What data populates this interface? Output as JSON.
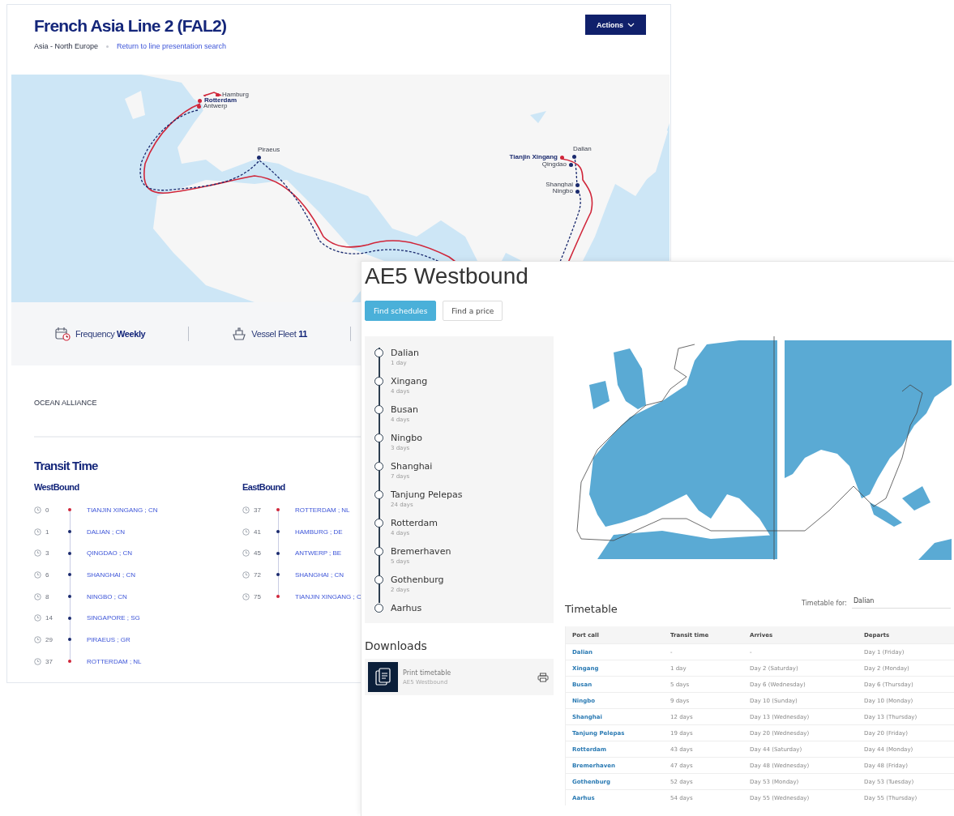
{
  "line_page": {
    "title": "French Asia Line 2 (FAL2)",
    "trade": "Asia - North Europe",
    "back_link": "Return to line presentation search",
    "actions_button": "Actions",
    "map": {
      "ports": [
        {
          "label": "Hamburg",
          "emphasized": false,
          "color": "#d0263a"
        },
        {
          "label": "Rotterdam",
          "emphasized": true,
          "color": "#d0263a"
        },
        {
          "label": "Antwerp",
          "emphasized": false,
          "color": "#d0263a"
        },
        {
          "label": "Piraeus",
          "emphasized": false,
          "color": "#1a2a6e"
        },
        {
          "label": "Tianjin Xingang",
          "emphasized": true,
          "color": "#d0263a"
        },
        {
          "label": "Dalian",
          "emphasized": false,
          "color": "#1a2a6e"
        },
        {
          "label": "Qingdao",
          "emphasized": false,
          "color": "#1a2a6e"
        },
        {
          "label": "Shanghai",
          "emphasized": false,
          "color": "#1a2a6e"
        },
        {
          "label": "Ningbo",
          "emphasized": false,
          "color": "#1a2a6e"
        }
      ]
    },
    "stats": [
      {
        "kind": "frequency",
        "label": "Frequency",
        "value": "Weekly"
      },
      {
        "kind": "fleet",
        "label": "Vessel Fleet",
        "value": "11"
      }
    ],
    "alliance": "OCEAN ALLIANCE",
    "transit_title": "Transit Time",
    "directions": [
      {
        "title": "WestBound",
        "stops": [
          {
            "days": "0",
            "port": "TIANJIN XINGANG ; CN",
            "color": "#d0263a"
          },
          {
            "days": "1",
            "port": "DALIAN ; CN",
            "color": "#1a2a6e"
          },
          {
            "days": "3",
            "port": "QINGDAO ; CN",
            "color": "#1a2a6e"
          },
          {
            "days": "6",
            "port": "SHANGHAI ; CN",
            "color": "#1a2a6e"
          },
          {
            "days": "8",
            "port": "NINGBO ; CN",
            "color": "#1a2a6e"
          },
          {
            "days": "14",
            "port": "SINGAPORE ; SG",
            "color": "#1a2a6e"
          },
          {
            "days": "29",
            "port": "PIRAEUS ; GR",
            "color": "#1a2a6e"
          },
          {
            "days": "37",
            "port": "ROTTERDAM ; NL",
            "color": "#d0263a"
          }
        ]
      },
      {
        "title": "EastBound",
        "stops": [
          {
            "days": "37",
            "port": "ROTTERDAM ; NL",
            "color": "#d0263a"
          },
          {
            "days": "41",
            "port": "HAMBURG ; DE",
            "color": "#1a2a6e"
          },
          {
            "days": "45",
            "port": "ANTWERP ; BE",
            "color": "#1a2a6e"
          },
          {
            "days": "72",
            "port": "SHANGHAI ; CN",
            "color": "#1a2a6e"
          },
          {
            "days": "75",
            "port": "TIANJIN XINGANG ; C",
            "color": "#d0263a"
          }
        ]
      }
    ]
  },
  "service_page": {
    "title": "AE5 Westbound",
    "buttons": [
      {
        "label": "Find schedules",
        "primary": true
      },
      {
        "label": "Find a price",
        "primary": false
      }
    ],
    "stops": [
      {
        "name": "Dalian",
        "duration": "1 day"
      },
      {
        "name": "Xingang",
        "duration": "4 days"
      },
      {
        "name": "Busan",
        "duration": "4 days"
      },
      {
        "name": "Ningbo",
        "duration": "3 days"
      },
      {
        "name": "Shanghai",
        "duration": "7 days"
      },
      {
        "name": "Tanjung Pelepas",
        "duration": "24 days"
      },
      {
        "name": "Rotterdam",
        "duration": "4 days"
      },
      {
        "name": "Bremerhaven",
        "duration": "5 days"
      },
      {
        "name": "Gothenburg",
        "duration": "2 days"
      },
      {
        "name": "Aarhus"
      }
    ],
    "downloads": {
      "title": "Downloads",
      "items": [
        {
          "title": "Print timetable",
          "subtitle": "AE5 Westbound"
        }
      ]
    },
    "timetable": {
      "title": "Timetable",
      "filter_label": "Timetable for:",
      "filter_value": "Dalian",
      "columns": [
        "Port call",
        "Transit time",
        "Arrives",
        "Departs"
      ],
      "rows": [
        [
          "Dalian",
          "-",
          "-",
          "Day 1 (Friday)"
        ],
        [
          "Xingang",
          "1 day",
          "Day 2 (Saturday)",
          "Day 2 (Monday)"
        ],
        [
          "Busan",
          "5 days",
          "Day 6 (Wednesday)",
          "Day 6 (Thursday)"
        ],
        [
          "Ningbo",
          "9 days",
          "Day 10 (Sunday)",
          "Day 10 (Monday)"
        ],
        [
          "Shanghai",
          "12 days",
          "Day 13 (Wednesday)",
          "Day 13 (Thursday)"
        ],
        [
          "Tanjung Pelepas",
          "19 days",
          "Day 20 (Wednesday)",
          "Day 20 (Friday)"
        ],
        [
          "Rotterdam",
          "43 days",
          "Day 44 (Saturday)",
          "Day 44 (Monday)"
        ],
        [
          "Bremerhaven",
          "47 days",
          "Day 48 (Wednesday)",
          "Day 48 (Friday)"
        ],
        [
          "Gothenburg",
          "52 days",
          "Day 53 (Monday)",
          "Day 53 (Tuesday)"
        ],
        [
          "Aarhus",
          "54 days",
          "Day 55 (Wednesday)",
          "Day 55 (Thursday)"
        ]
      ]
    }
  }
}
